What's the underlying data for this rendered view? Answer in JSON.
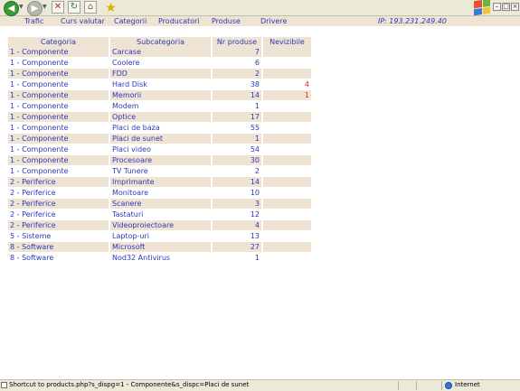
{
  "browser": {
    "back_icon": "back-arrow-icon",
    "forward_icon": "forward-arrow-icon",
    "stop_icon": "stop-icon",
    "refresh_icon": "refresh-icon",
    "home_icon": "home-icon",
    "favorites_icon": "star-icon"
  },
  "nav": {
    "items": [
      "Trafic",
      "Curs valutar",
      "Categorii",
      "Producatori",
      "Produse",
      "Drivere"
    ],
    "ip": "IP:  193.231.249.40"
  },
  "table": {
    "headers": [
      "Categoria",
      "Subcategoria",
      "Nr produse",
      "Nevizibile"
    ],
    "rows": [
      {
        "categoria": "1 - Componente",
        "subcategoria": "Carcase",
        "nr": "7",
        "nevizibile": ""
      },
      {
        "categoria": "1 - Componente",
        "subcategoria": "Coolere",
        "nr": "6",
        "nevizibile": ""
      },
      {
        "categoria": "1 - Componente",
        "subcategoria": "FDD",
        "nr": "2",
        "nevizibile": ""
      },
      {
        "categoria": "1 - Componente",
        "subcategoria": "Hard Disk",
        "nr": "38",
        "nevizibile": "4"
      },
      {
        "categoria": "1 - Componente",
        "subcategoria": "Memorii",
        "nr": "14",
        "nevizibile": "1"
      },
      {
        "categoria": "1 - Componente",
        "subcategoria": "Modem",
        "nr": "1",
        "nevizibile": ""
      },
      {
        "categoria": "1 - Componente",
        "subcategoria": "Optice",
        "nr": "17",
        "nevizibile": ""
      },
      {
        "categoria": "1 - Componente",
        "subcategoria": "Placi de baza",
        "nr": "55",
        "nevizibile": ""
      },
      {
        "categoria": "1 - Componente",
        "subcategoria": "Placi de sunet",
        "nr": "1",
        "nevizibile": ""
      },
      {
        "categoria": "1 - Componente",
        "subcategoria": "Placi video",
        "nr": "54",
        "nevizibile": ""
      },
      {
        "categoria": "1 - Componente",
        "subcategoria": "Procesoare",
        "nr": "30",
        "nevizibile": ""
      },
      {
        "categoria": "1 - Componente",
        "subcategoria": "TV Tunere",
        "nr": "2",
        "nevizibile": ""
      },
      {
        "categoria": "2 - Periferice",
        "subcategoria": "Imprimante",
        "nr": "14",
        "nevizibile": ""
      },
      {
        "categoria": "2 - Periferice",
        "subcategoria": "Monitoare",
        "nr": "10",
        "nevizibile": ""
      },
      {
        "categoria": "2 - Periferice",
        "subcategoria": "Scanere",
        "nr": "3",
        "nevizibile": ""
      },
      {
        "categoria": "2 - Periferice",
        "subcategoria": "Tastaturi",
        "nr": "12",
        "nevizibile": ""
      },
      {
        "categoria": "2 - Periferice",
        "subcategoria": "Videoproiectoare",
        "nr": "4",
        "nevizibile": ""
      },
      {
        "categoria": "5 - Sisteme",
        "subcategoria": "Laptop-uri",
        "nr": "13",
        "nevizibile": ""
      },
      {
        "categoria": "8 - Software",
        "subcategoria": "Microsoft",
        "nr": "27",
        "nevizibile": ""
      },
      {
        "categoria": "8 - Software",
        "subcategoria": "Nod32 Antivirus",
        "nr": "1",
        "nevizibile": ""
      }
    ]
  },
  "status": {
    "text": "Shortcut to products.php?s_dispg=1 - Componente&s_dispc=Placi de sunet",
    "zone": "Internet"
  },
  "colors": {
    "link": "#2b3bb8",
    "row_shade": "#efe3d4",
    "alert": "#cc2a2a"
  }
}
